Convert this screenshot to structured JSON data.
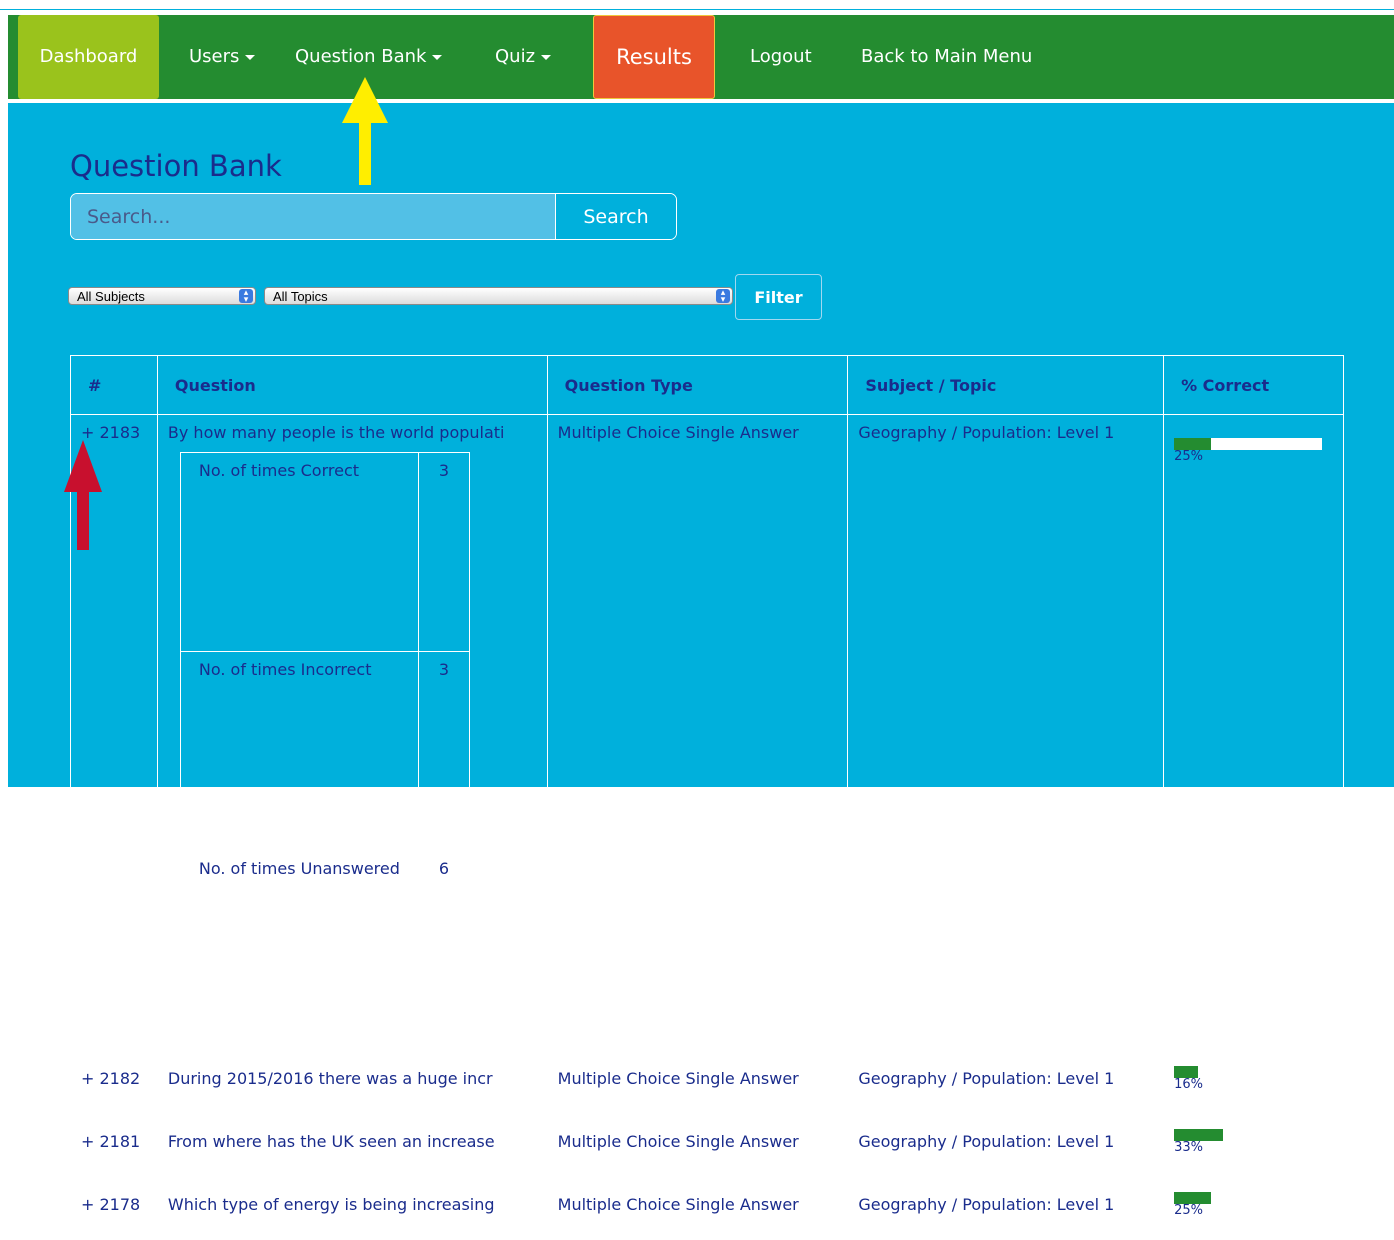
{
  "nav": {
    "dashboard": "Dashboard",
    "users": "Users",
    "question_bank": "Question Bank",
    "quiz": "Quiz",
    "results": "Results",
    "logout": "Logout",
    "back": "Back to Main Menu"
  },
  "page": {
    "title": "Question Bank"
  },
  "search": {
    "placeholder": "Search...",
    "button": "Search"
  },
  "filters": {
    "subject": "All Subjects",
    "topic": "All Topics",
    "button": "Filter"
  },
  "table": {
    "headers": [
      "#",
      "Question",
      "Question Type",
      "Subject / Topic",
      "% Correct"
    ],
    "rows": [
      {
        "id": "+ 2183",
        "question": "By how many people is the world populati",
        "type": "Multiple Choice Single Answer",
        "subject": "Geography / Population: Level 1",
        "pct": 25,
        "pct_label": "25%"
      },
      {
        "id": "+ 2182",
        "question": "During 2015/2016 there was a huge incr",
        "type": "Multiple Choice Single Answer",
        "subject": "Geography / Population: Level 1",
        "pct": 16,
        "pct_label": "16%"
      },
      {
        "id": "+ 2181",
        "question": "From where has the UK seen an increase",
        "type": "Multiple Choice Single Answer",
        "subject": "Geography / Population: Level 1",
        "pct": 33,
        "pct_label": "33%"
      },
      {
        "id": "+ 2178",
        "question": "Which type of energy is being increasing",
        "type": "Multiple Choice Single Answer",
        "subject": "Geography / Population: Level 1",
        "pct": 25,
        "pct_label": "25%"
      }
    ],
    "stats": [
      {
        "label": "No. of times Correct",
        "value": "3"
      },
      {
        "label": "No. of times Incorrect",
        "value": "3"
      },
      {
        "label": "No. of times Unanswered",
        "value": "6"
      }
    ]
  },
  "colors": {
    "nav_bg": "#248c30",
    "dashboard_bg": "#9ac31c",
    "results_bg": "#e8542a",
    "page_bg": "#00b0dc",
    "text": "#1a2c8c",
    "bar": "#248c30",
    "arrow_yellow": "#ffee00",
    "arrow_red": "#c8102e"
  }
}
